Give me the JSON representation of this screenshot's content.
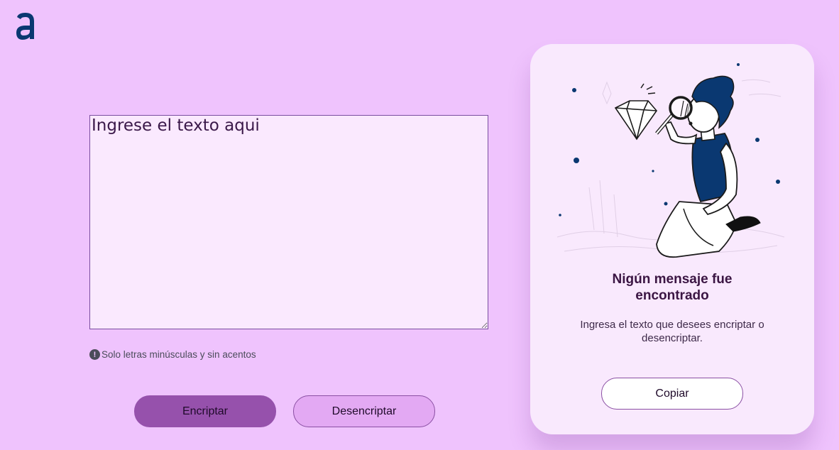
{
  "brand": {
    "logo_icon": "alura-logo-icon",
    "color": "#0a3871"
  },
  "input": {
    "placeholder": "Ingrese el texto aqui",
    "value": ""
  },
  "hint": {
    "icon": "exclamation-icon",
    "text": "Solo letras minúsculas y sin acentos"
  },
  "actions": {
    "encrypt_label": "Encriptar",
    "decrypt_label": "Desencriptar"
  },
  "output": {
    "illustration": "person-with-magnifier-illustration",
    "title": "Nigún mensaje fue encontrado",
    "description": "Ingresa el texto que desees encriptar o desencriptar.",
    "copy_label": "Copiar"
  },
  "colors": {
    "background": "#efc3fd",
    "primary_button": "#9651ac",
    "secondary_button": "#e3a9f3",
    "card": "#f9e9fd"
  }
}
